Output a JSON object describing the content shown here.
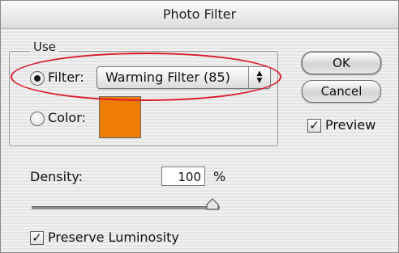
{
  "window": {
    "title": "Photo Filter"
  },
  "use_group": {
    "label": "Use",
    "filter_radio": {
      "label": "Filter:",
      "selected": true
    },
    "filter_select": {
      "value": "Warming Filter (85)"
    },
    "color_radio": {
      "label": "Color:",
      "selected": false
    },
    "color_swatch": {
      "color": "#f07c08"
    }
  },
  "buttons": {
    "ok": "OK",
    "cancel": "Cancel"
  },
  "preview": {
    "label": "Preview",
    "checked": true
  },
  "density": {
    "label": "Density:",
    "value": "100",
    "unit": "%",
    "slider_level": 1.0
  },
  "preserve_luminosity": {
    "label": "Preserve Luminosity",
    "checked": true
  },
  "annotation": {
    "color": "#d81b2b"
  }
}
